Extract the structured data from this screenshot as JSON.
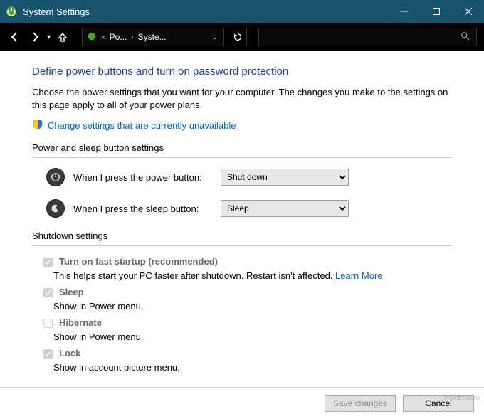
{
  "window": {
    "title": "System Settings"
  },
  "breadcrumb": {
    "prefix": "«",
    "item1": "Po...",
    "item2": "Syste..."
  },
  "page": {
    "heading": "Define power buttons and turn on password protection",
    "subtext": "Choose the power settings that you want for your computer. The changes you make to the settings on this page apply to all of your power plans.",
    "change_link": "Change settings that are currently unavailable"
  },
  "group_power": {
    "label": "Power and sleep button settings",
    "power_label": "When I press the power button:",
    "power_value": "Shut down",
    "sleep_label": "When I press the sleep button:",
    "sleep_value": "Sleep"
  },
  "group_shutdown": {
    "label": "Shutdown settings",
    "fast_startup": {
      "label": "Turn on fast startup (recommended)",
      "desc_prefix": "This helps start your PC faster after shutdown. Restart isn't affected.",
      "learn_more": "Learn More",
      "checked": true
    },
    "sleep": {
      "label": "Sleep",
      "desc": "Show in Power menu.",
      "checked": true
    },
    "hibernate": {
      "label": "Hibernate",
      "desc": "Show in Power menu.",
      "checked": false
    },
    "lock": {
      "label": "Lock",
      "desc": "Show in account picture menu.",
      "checked": true
    }
  },
  "footer": {
    "save": "Save changes",
    "cancel": "Cancel"
  },
  "watermark": "wsxdn.com"
}
